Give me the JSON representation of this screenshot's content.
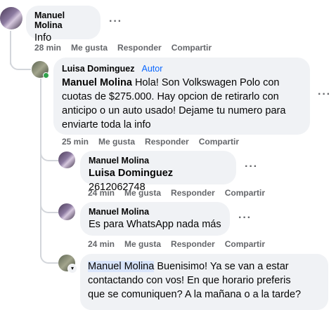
{
  "comments": [
    {
      "author": "Manuel Molina",
      "text": "Info",
      "time": "28 min",
      "like": "Me gusta",
      "reply": "Responder",
      "share": "Compartir"
    },
    {
      "author": "Luisa Dominguez",
      "badge": "Autor",
      "mention": "Manuel Molina",
      "text": "Hola! Son Volkswagen Polo con cuotas de $275.000. Hay opcion de retirarlo con anticipo o un auto usado! Dejame tu numero para enviarte toda la info",
      "line1": "Hola! Son Volkswagen Polo con",
      "line2": "cuotas de $275.000. Hay opcion de retirarlo con",
      "line3": "anticipo o un auto usado! Dejame tu numero para",
      "line4": "enviarte toda la info",
      "time": "25 min",
      "like": "Me gusta",
      "reply": "Responder",
      "share": "Compartir"
    },
    {
      "author": "Manuel Molina",
      "mention": "Luisa Dominguez",
      "text": "2612062748",
      "time": "24 min",
      "like": "Me gusta",
      "reply": "Responder",
      "share": "Compartir"
    },
    {
      "author": "Manuel Molina",
      "text": "Es para WhatsApp nada más",
      "time": "24 min",
      "like": "Me gusta",
      "reply": "Responder",
      "share": "Compartir"
    },
    {
      "mention": "Manuel Molina",
      "line1": "Buenisimo! Ya se van a estar",
      "line2": "contactando con vos! En que horario preferis",
      "line3": "que se comuniquen? A la mañana o a la tarde?"
    }
  ],
  "more_icon": "more-horizontal-icon",
  "colors": {
    "badge": "#0866ff",
    "online": "#31a24c",
    "highlight_bubble": "#e7f0fd"
  }
}
